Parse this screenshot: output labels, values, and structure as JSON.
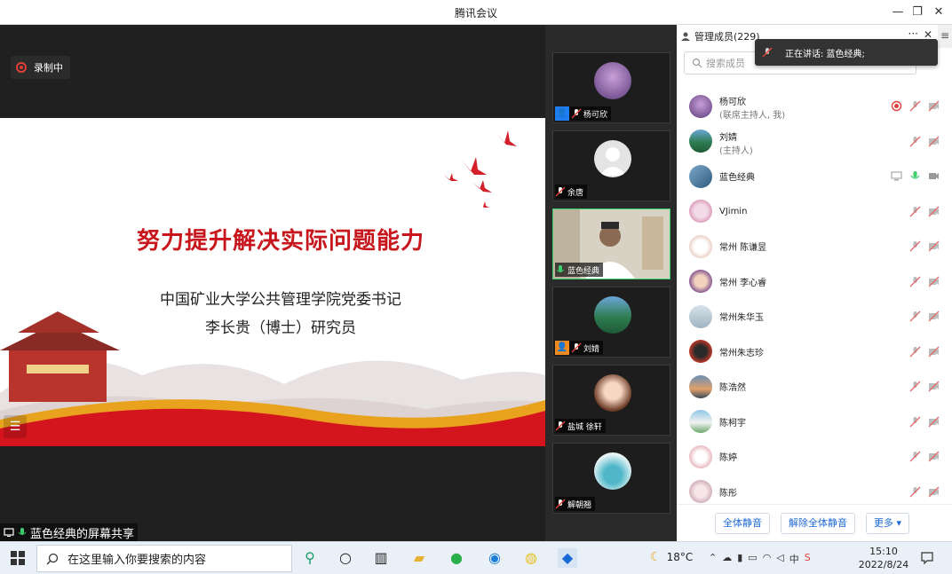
{
  "window": {
    "title": "腾讯会议",
    "minimize": "—",
    "restore": "❐",
    "close": "✕"
  },
  "recording": {
    "label": "录制中"
  },
  "slide": {
    "title": "努力提升解决实际问题能力",
    "line1": "中国矿业大学公共管理学院党委书记",
    "line2": "李长贵（博士）研究员"
  },
  "share_label": "蓝色经典的屏幕共享",
  "video_tiles": [
    {
      "name": "杨可欣"
    },
    {
      "name": "余唐"
    },
    {
      "name": "蓝色经典"
    },
    {
      "name": "刘婧"
    },
    {
      "name": "盐城 徐轩"
    },
    {
      "name": "解朝翘"
    }
  ],
  "panel": {
    "title": "管理成员(229)",
    "more": "···",
    "close": "✕",
    "side": "≡",
    "search_placeholder": "搜索成员",
    "speaking": "正在讲话: 蓝色经典;",
    "members": [
      {
        "name": "杨可欣",
        "role": "(联席主持人, 我)"
      },
      {
        "name": "刘婧",
        "role": "(主持人)"
      },
      {
        "name": "蓝色经典",
        "role": ""
      },
      {
        "name": "VJimin",
        "role": ""
      },
      {
        "name": "常州 陈谦昱",
        "role": ""
      },
      {
        "name": "常州 李心睿",
        "role": ""
      },
      {
        "name": "常州朱华玉",
        "role": ""
      },
      {
        "name": "常州朱志珍",
        "role": ""
      },
      {
        "name": "陈浩然",
        "role": ""
      },
      {
        "name": "陈柯宇",
        "role": ""
      },
      {
        "name": "陈婷",
        "role": ""
      },
      {
        "name": "陈彤",
        "role": ""
      }
    ],
    "footer": {
      "mute_all": "全体静音",
      "unmute_all": "解除全体静音",
      "more": "更多 ▾"
    }
  },
  "taskbar": {
    "search_text": "在这里输入你要搜索的内容",
    "temperature": "18°C",
    "ime": "中",
    "time": "15:10",
    "date": "2022/8/24"
  }
}
